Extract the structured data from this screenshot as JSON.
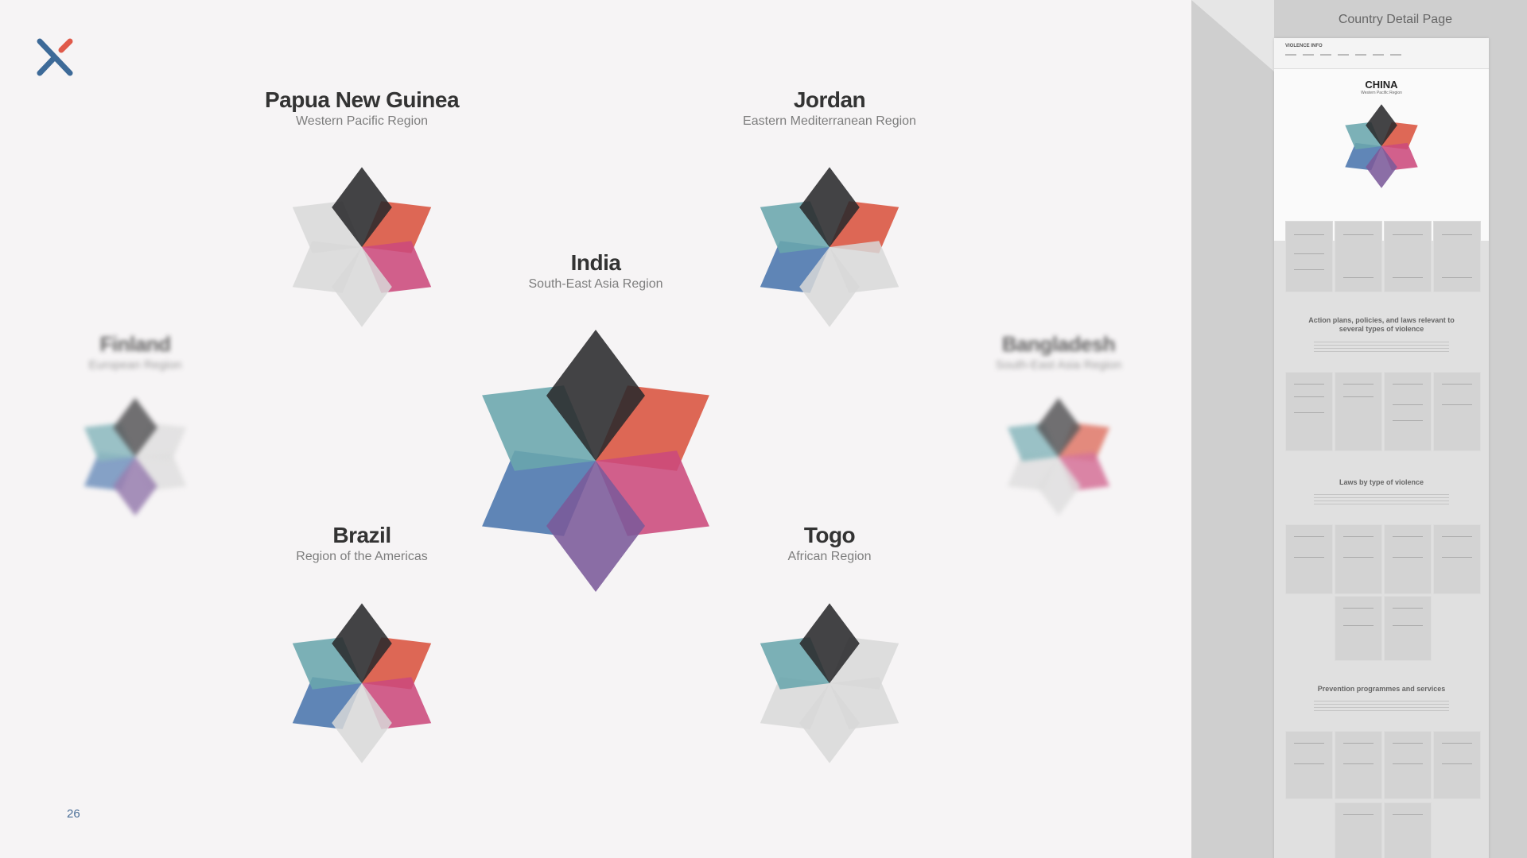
{
  "page": {
    "page_number": "26"
  },
  "countries": {
    "india": {
      "name": "India",
      "region": "South-East Asia Region"
    },
    "papua_new_guinea": {
      "name": "Papua New Guinea",
      "region": "Western Pacific Region"
    },
    "jordan": {
      "name": "Jordan",
      "region": "Eastern Mediterranean Region"
    },
    "finland": {
      "name": "Finland",
      "region": "European Region"
    },
    "bangladesh": {
      "name": "Bangladesh",
      "region": "South-East Asia Region"
    },
    "brazil": {
      "name": "Brazil",
      "region": "Region of the Americas"
    },
    "togo": {
      "name": "Togo",
      "region": "African Region"
    }
  },
  "colors": {
    "petal_top": "#2a2a2c",
    "petal_upper_right": "#d9533f",
    "petal_lower_right": "#cc4a7c",
    "petal_bottom": "#7b5a9a",
    "petal_lower_left": "#4a75ad",
    "petal_upper_left": "#6aa6ad",
    "petal_inactive": "#d8d8d8",
    "logo_blue": "#3d6a98",
    "logo_red": "#e05a4a",
    "page_number": "#4a6e97"
  },
  "side_panel": {
    "title": "Country Detail Page",
    "preview": {
      "brand": "VIOLENCE INFO",
      "country": "CHINA",
      "region": "Western Pacific Region",
      "sections": [
        "Action plans, policies, and laws relevant to several types of violence",
        "Laws by type of violence",
        "Prevention programmes and services"
      ]
    }
  }
}
